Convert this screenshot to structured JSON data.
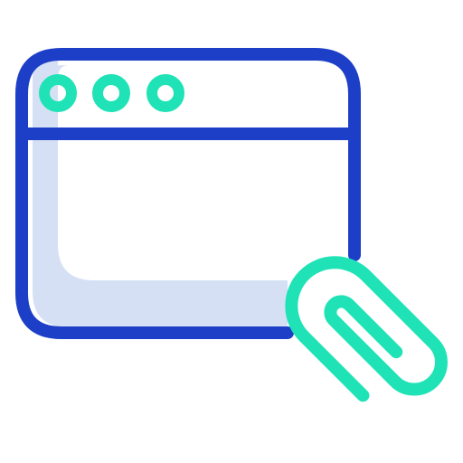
{
  "icon": {
    "name": "browser-window-attachment-icon",
    "colors": {
      "outline_blue": "#1D3FC8",
      "fill_light_blue": "#D6E0F5",
      "accent_teal": "#1FE3B6",
      "background": "#FFFFFF"
    },
    "parts": [
      "browser-window-icon",
      "window-control-dots-icon",
      "paperclip-icon"
    ]
  }
}
